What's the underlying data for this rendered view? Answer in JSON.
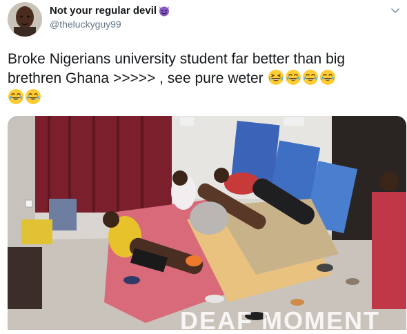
{
  "user": {
    "display_name": "Not your regular devil",
    "handle": "@theluckyguy99",
    "badge_icon": "smiling-devil-emoji"
  },
  "tweet": {
    "text_line1": "Broke Nigerians university student far better than big",
    "text_line2": "brethren Ghana >>>>> , see pure weter",
    "emojis": [
      "grinning-squinting-face",
      "face-with-tears-of-joy",
      "face-with-tears-of-joy",
      "face-with-tears-of-joy",
      "face-with-tears-of-joy",
      "face-with-tears-of-joy"
    ]
  },
  "media": {
    "watermark": "DEAF MOMENT"
  },
  "colors": {
    "text": "#14171a",
    "muted": "#657786",
    "devil": "#8b5cc8"
  }
}
